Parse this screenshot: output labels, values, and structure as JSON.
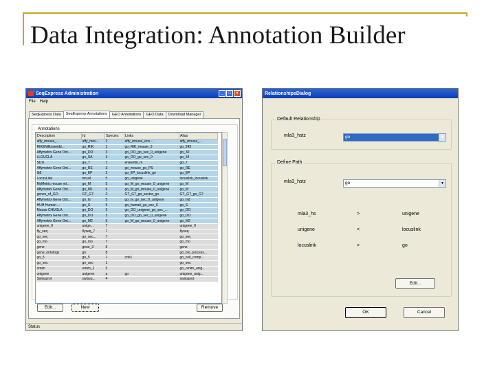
{
  "slide": {
    "title": "Data Integration: Annotation Builder"
  },
  "admin_window": {
    "title": "SeqExpress Administration",
    "menu": [
      "File",
      "Help"
    ],
    "tabs": [
      "SeqExpress Data",
      "SeqExpress Annotations",
      "GEO Annotations",
      "GEO Data",
      "Download Manager"
    ],
    "group_label": "Annotations",
    "columns": [
      "Description",
      "Id",
      "Species",
      "Links",
      "Alias"
    ],
    "rows": [
      {
        "d": "affy_mouse_...",
        "i": "affy_mou...",
        "s": "2",
        "l": "affy_mouse_ens...",
        "a": "affy_mouse_...",
        "sel": true
      },
      {
        "d": "RIKEN/Ensembl...",
        "i": "go_RIK",
        "s": "1",
        "l": "go_RIK_mouse_3",
        "a": "go_243",
        "sel": true
      },
      {
        "d": "Affymetrix Gene Ont...",
        "i": "go_DO",
        "s": "3",
        "l": "go_DO_go_sec_0_unigene",
        "a": "go_30",
        "sel": true
      },
      {
        "d": "LLGUCLA",
        "i": "go_SA",
        "s": "3",
        "l": "go_DO_go_sec_0",
        "a": "go_34",
        "sel": true
      },
      {
        "d": "Sb:8",
        "i": "go_7",
        "s": "7",
        "l": "ensembl_m",
        "a": "go_7",
        "sel": true
      },
      {
        "d": "Affymetrix Gene Ont...",
        "i": "go_RE",
        "s": "3",
        "l": "go_mouse_go_PS",
        "a": "go_RE",
        "sel": true
      },
      {
        "d": "Ib5",
        "i": "go_EP",
        "s": "2",
        "l": "go_EP_locuslink_go",
        "a": "go_EP",
        "sel": true
      },
      {
        "d": "LocusLink",
        "i": "locusl",
        "s": "5",
        "l": "go_unigene",
        "a": "locuslink_locuslink",
        "sel": true
      },
      {
        "d": "MyMetric mouse ml...",
        "i": "go_M",
        "s": "5",
        "l": "go_M_go_mouse_0_unigene",
        "a": "go_M",
        "sel": true
      },
      {
        "d": "Affymetrix Gene Ont...",
        "i": "go_M1",
        "s": "6",
        "l": "go_M_go_mouse_0_unigene",
        "a": "go_M",
        "sel": true
      },
      {
        "d": "genes_of_GO",
        "i": "GT_G7",
        "s": "2",
        "l": "GT_G7_go_sector_go",
        "a": "GT_G7_go_G7",
        "sel": true
      },
      {
        "d": "Affymetrix Gene Ont...",
        "i": "go_Is",
        "s": "5",
        "l": "go_Is_go_sec_0_unigene",
        "a": "go_Isd",
        "sel": true
      },
      {
        "d": "HUH Human ...",
        "i": "go_S",
        "s": "5",
        "l": "go_human_go_sec_0",
        "a": "go_S",
        "sel": true
      },
      {
        "d": "Mouse CHUGLA",
        "i": "go_DO",
        "s": "3",
        "l": "go_DO_unigene_go_sec_...",
        "a": "go_DO",
        "sel": true
      },
      {
        "d": "Affymetrix Gene Ont...",
        "i": "go_DO",
        "s": "3",
        "l": "go_DO_go_sec_0_unigene",
        "a": "go_DO",
        "sel": true
      },
      {
        "d": "Affymetrix Gene Ont...",
        "i": "go_M2",
        "s": "5",
        "l": "go_M_go_mouse_0_unigene",
        "a": "go_M2",
        "sel": true
      },
      {
        "d": "unigene_II",
        "i": "unige...",
        "s": "7",
        "l": "",
        "a": "unigene_II",
        "sel": false
      },
      {
        "d": "fly_seq",
        "i": "flyseq_7",
        "s": "7",
        "l": "",
        "a": "flyseq",
        "sel": false
      },
      {
        "d": "go_sec",
        "i": "go_sec...",
        "s": "7",
        "l": "",
        "a": "go_sec",
        "sel": false
      },
      {
        "d": "go_mo",
        "i": "go_mo",
        "s": "7",
        "l": "",
        "a": "go_mo",
        "sel": false
      },
      {
        "d": "gene",
        "i": "gene_3",
        "s": "6",
        "l": "",
        "a": "gene",
        "sel": false
      },
      {
        "d": "gene_ontology",
        "i": "go",
        "s": "8",
        "l": "",
        "a": "go_bio_process...",
        "sel": false
      },
      {
        "d": "go_5",
        "i": "go_5",
        "s": "1",
        "l": "cob1",
        "a": "go_cell_comp...",
        "sel": false
      },
      {
        "d": "go_sec",
        "i": "go_sec",
        "s": "1",
        "l": "",
        "a": "go_sec",
        "sel": false
      },
      {
        "d": "omim",
        "i": "omim_2",
        "s": "5",
        "l": "",
        "a": "go_omim_unig...",
        "sel": false
      },
      {
        "d": "unigene",
        "i": "unigene",
        "s": "a",
        "l": "go",
        "a": "unigene_unig...",
        "sel": false
      },
      {
        "d": "Swissprot",
        "i": "swissp...",
        "s": "4",
        "l": "",
        "a": "swissprot",
        "sel": false
      }
    ],
    "buttons": {
      "edit": "Edit...",
      "new": "New",
      "remove": "Remove"
    },
    "status": "Status"
  },
  "relationships_dialog": {
    "title": "RelationshipsDialog",
    "default_relationship": {
      "label": "Default Relationship",
      "field_label": "mla3_hstz",
      "value": "go"
    },
    "define_path": {
      "label": "Define Path",
      "field_label": "mla3_hstz",
      "value": "go",
      "rows": [
        {
          "from": "mla3_hs",
          "op": ">",
          "to": "unigene"
        },
        {
          "from": "unigene",
          "op": "<",
          "to": "locuslink"
        },
        {
          "from": "locuslink",
          "op": ">",
          "to": "go"
        }
      ],
      "edit_label": "Edit..."
    },
    "buttons": {
      "ok": "OK",
      "cancel": "Cancel"
    }
  },
  "colors": {
    "selected_row": "#b4d5e8",
    "unselected_row": "#dcdcdc",
    "titlebar": "#0a3fb4",
    "frame_accent": "#c8a526"
  }
}
